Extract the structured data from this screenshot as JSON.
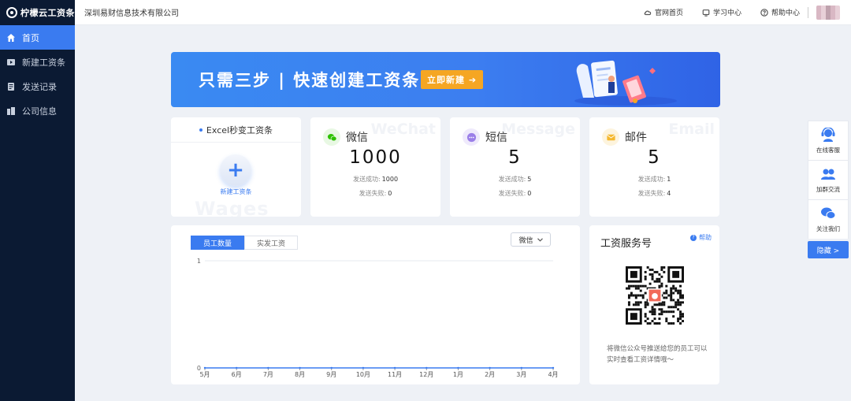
{
  "logo": {
    "text": "柠檬云工资条"
  },
  "sidebar": {
    "items": [
      {
        "label": "首页",
        "icon": "home-icon",
        "active": true
      },
      {
        "label": "新建工资条",
        "icon": "play-icon",
        "active": false
      },
      {
        "label": "发送记录",
        "icon": "list-icon",
        "active": false
      },
      {
        "label": "公司信息",
        "icon": "building-icon",
        "active": false
      }
    ]
  },
  "header": {
    "company": "深圳易财信息技术有限公司",
    "links": [
      {
        "label": "官网首页",
        "icon": "cloud-icon"
      },
      {
        "label": "学习中心",
        "icon": "monitor-icon"
      },
      {
        "label": "帮助中心",
        "icon": "help-icon"
      }
    ]
  },
  "banner": {
    "text": "只需三步 | 快速创建工资条",
    "button": "立即新建 ➔"
  },
  "excel_card": {
    "title": "Excel秒变工资条",
    "action": "新建工资条",
    "watermark": "Wages"
  },
  "stats": [
    {
      "name": "微信",
      "watermark": "WeChat",
      "total": "1000",
      "success_label": "发送成功:",
      "success": "1000",
      "fail_label": "发送失败:",
      "fail": "0",
      "icon": "wechat-icon",
      "color": "#2dc100",
      "bg": "#e8f8e3"
    },
    {
      "name": "短信",
      "watermark": "Message",
      "total": "5",
      "success_label": "发送成功:",
      "success": "5",
      "fail_label": "发送失败:",
      "fail": "0",
      "icon": "sms-icon",
      "color": "#9b7fe8",
      "bg": "#efeafc"
    },
    {
      "name": "邮件",
      "watermark": "Email",
      "total": "5",
      "success_label": "发送成功:",
      "success": "1",
      "fail_label": "发送失败:",
      "fail": "4",
      "icon": "mail-icon",
      "color": "#f5b82e",
      "bg": "#fdf4de"
    }
  ],
  "chart_panel": {
    "tabs": [
      "员工数量",
      "实发工资"
    ],
    "active_tab": 0,
    "select": "微信"
  },
  "chart_data": {
    "type": "line",
    "categories": [
      "5月",
      "6月",
      "7月",
      "8月",
      "9月",
      "10月",
      "11月",
      "12月",
      "1月",
      "2月",
      "3月",
      "4月"
    ],
    "series": [
      {
        "values": [
          0,
          0,
          0,
          0,
          0,
          0,
          0,
          0,
          0,
          0,
          0,
          0
        ]
      }
    ],
    "yticks": [
      "0",
      "1"
    ],
    "ylim": [
      0,
      1
    ],
    "color": "#3a7bf0",
    "grid": true
  },
  "qr_card": {
    "title": "工资服务号",
    "help": "帮助",
    "desc": "将微信公众号推送给您的员工可以实时查看工资详情哦～"
  },
  "float_bar": {
    "items": [
      {
        "label": "在线客服",
        "icon": "customer-service-icon"
      },
      {
        "label": "加群交流",
        "icon": "group-icon"
      },
      {
        "label": "关注我们",
        "icon": "wechat-follow-icon"
      }
    ],
    "collapse": "隐藏 >"
  }
}
